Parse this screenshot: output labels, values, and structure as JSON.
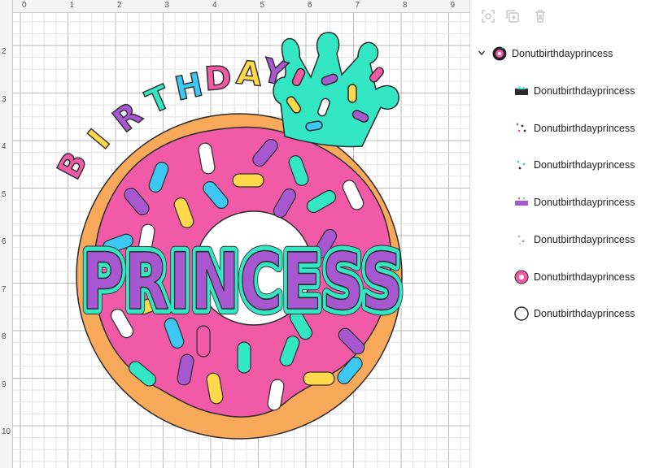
{
  "ruler": {
    "top": [
      "0",
      "1",
      "2",
      "3",
      "4",
      "5",
      "6",
      "7",
      "8",
      "9"
    ],
    "left": [
      "2",
      "3",
      "4",
      "5",
      "6",
      "7",
      "8",
      "9",
      "10"
    ]
  },
  "design": {
    "arc_text": "BIRTHDAY",
    "main_text": "PRINCESS"
  },
  "toolbar": {
    "icons": [
      "focus-icon",
      "duplicate-icon",
      "delete-icon"
    ]
  },
  "layers": {
    "group": {
      "name": "Donutbirthdayprincess",
      "expanded": true
    },
    "children": [
      {
        "name": "Donutbirthdayprincess",
        "thumb": "crown-birthday-thumb"
      },
      {
        "name": "Donutbirthdayprincess",
        "thumb": "sprinkles-dots-thumb"
      },
      {
        "name": "Donutbirthdayprincess",
        "thumb": "sprinkles-blue-thumb"
      },
      {
        "name": "Donutbirthdayprincess",
        "thumb": "princess-text-thumb"
      },
      {
        "name": "Donutbirthdayprincess",
        "thumb": "sprinkles-white-thumb"
      },
      {
        "name": "Donutbirthdayprincess",
        "thumb": "donut-icing-thumb"
      },
      {
        "name": "Donutbirthdayprincess",
        "thumb": "donut-ring-thumb"
      }
    ]
  },
  "colors": {
    "dough": "#f9a95a",
    "icing": "#f05aa6",
    "mint": "#33e6c4",
    "blue": "#3cc8f2",
    "purple": "#a757cf",
    "yellow": "#ffd94a",
    "outline": "#2b2b2b"
  }
}
